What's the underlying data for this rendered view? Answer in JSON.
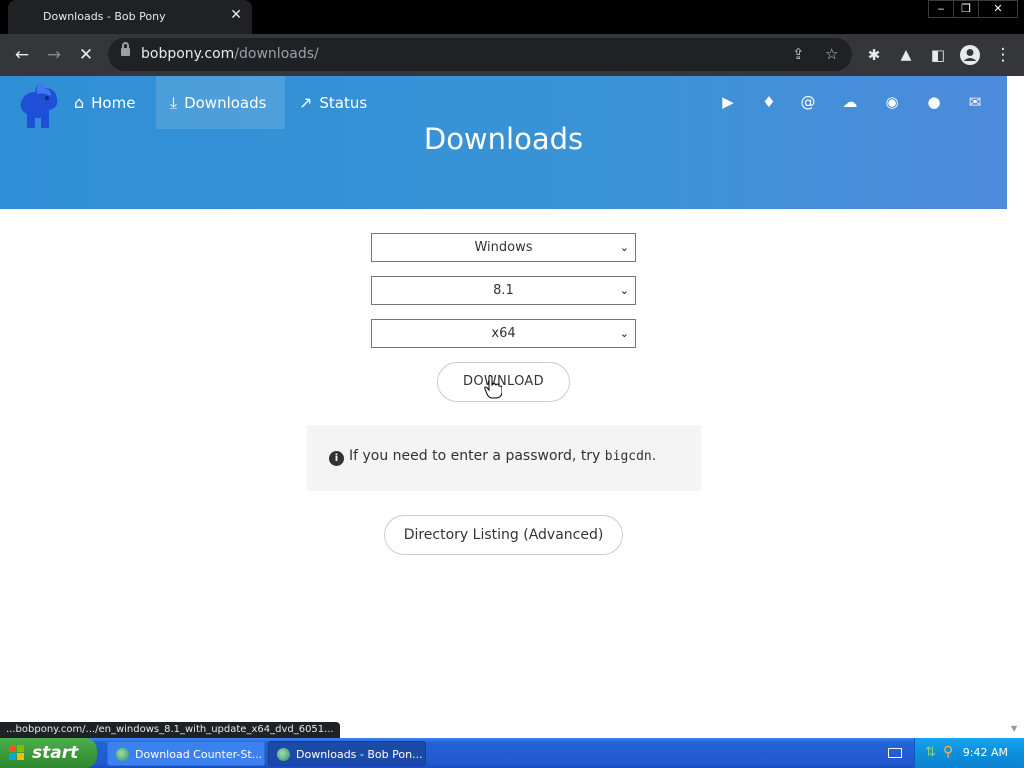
{
  "browser": {
    "tab_title": "Downloads - Bob Pony",
    "tab_close": "✕",
    "window_controls": {
      "minimize": "‒",
      "maximize": "❐",
      "close": "✕"
    },
    "url_host": "bobpony.com",
    "url_path": "/downloads/",
    "status_url": "...bobpony.com/.../en_windows_8.1_with_update_x64_dvd_6051..."
  },
  "nav": {
    "home": "Home",
    "downloads": "Downloads",
    "status": "Status",
    "social_icons": [
      "youtube-icon",
      "twitter-icon",
      "mastodon-icon",
      "cloud-icon",
      "discord-icon",
      "github-icon",
      "mail-icon"
    ]
  },
  "page": {
    "title": "Downloads",
    "os_select": "Windows",
    "version_select": "8.1",
    "arch_select": "x64",
    "download_button": "DOWNLOAD",
    "info_prefix": "If you need to enter a password, try ",
    "info_password": "bigcdn",
    "info_suffix": ".",
    "directory_button": "Directory Listing (Advanced)"
  },
  "taskbar": {
    "start_label": "start",
    "tasks": [
      "Download Counter-St...",
      "Downloads - Bob Pon..."
    ],
    "time": "9:42 AM"
  },
  "colors": {
    "hero": "#3a93d6",
    "taskbar": "#2058d0",
    "start": "#3b9a3b"
  }
}
